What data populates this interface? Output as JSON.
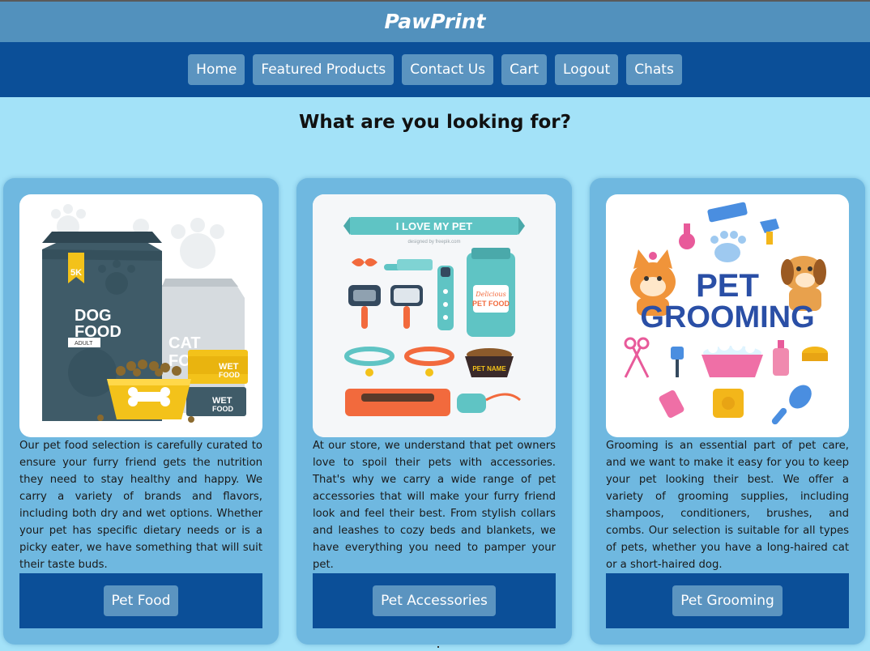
{
  "app": {
    "title": "PawPrint"
  },
  "nav": {
    "items": [
      "Home",
      "Featured Products",
      "Contact Us",
      "Cart",
      "Logout",
      "Chats"
    ]
  },
  "main": {
    "heading": "What are you looking for?",
    "cards": [
      {
        "image_icon": "dog-food-illustration",
        "image_text": {
          "dog": "DOG",
          "food": "FOOD",
          "adult": "ADULT",
          "size": "5K",
          "cat": "CAT",
          "cat_food": "FOOD",
          "wet": "WET",
          "wet_food": "FOOD"
        },
        "description": "Our pet food selection is carefully curated to ensure your furry friend gets the nutrition they need to stay healthy and happy. We carry a variety of brands and flavors, including both dry and wet options. Whether your pet has specific dietary needs or is a picky eater, we have something that will suit their taste buds.",
        "button": "Pet Food"
      },
      {
        "image_icon": "pet-accessories-illustration",
        "image_text": {
          "banner": "I LOVE MY PET",
          "credit": "designed by freepik.com",
          "food_line1": "Delicious",
          "food_line2": "PET FOOD",
          "bowl": "PET NAME"
        },
        "description": "At our store, we understand that pet owners love to spoil their pets with accessories. That's why we carry a wide range of pet accessories that will make your furry friend look and feel their best. From stylish collars and leashes to cozy beds and blankets, we have everything you need to pamper your pet.",
        "button": "Pet Accessories"
      },
      {
        "image_icon": "pet-grooming-illustration",
        "image_text": {
          "line1": "PET",
          "line2": "GROOMING"
        },
        "description": "Grooming is an essential part of pet care, and we want to make it easy for you to keep your pet looking their best. We offer a variety of grooming supplies, including shampoos, conditioners, brushes, and combs. Our selection is suitable for all types of pets, whether you have a long-haired cat or a short-haired dog.",
        "button": "Pet Grooming"
      }
    ]
  },
  "colors": {
    "page_bg": "#a3e2f8",
    "title_bar": "#5291bd",
    "nav_bar": "#0b4f98",
    "button": "#5b94c0",
    "card": "#6fb8e0"
  }
}
